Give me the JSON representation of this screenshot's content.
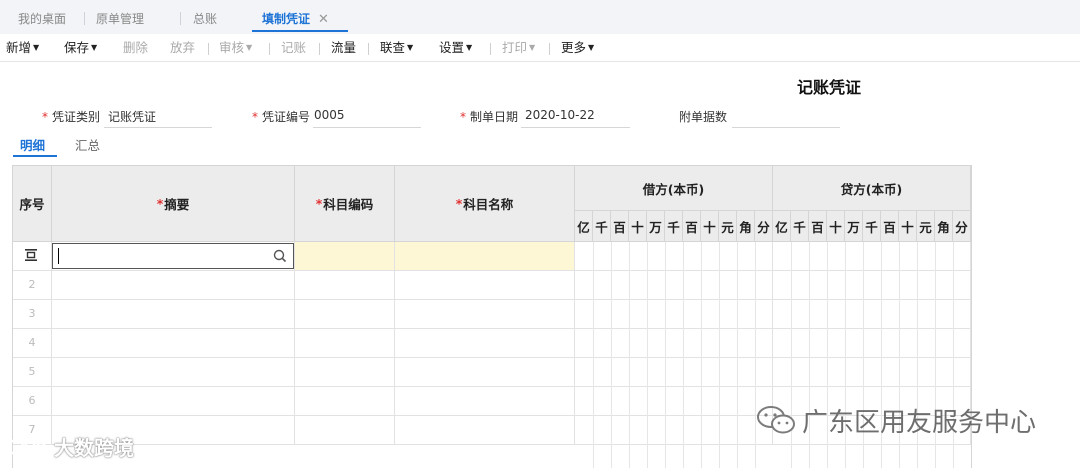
{
  "tabs": [
    {
      "label": "我的桌面"
    },
    {
      "label": "原单管理"
    },
    {
      "label": "总账"
    },
    {
      "label": "填制凭证",
      "close": "✕"
    }
  ],
  "toolbar": {
    "new": "新增",
    "save": "保存",
    "delete": "删除",
    "discard": "放弃",
    "review": "审核",
    "post": "记账",
    "flow": "流量",
    "query": "联查",
    "settings": "设置",
    "print": "打印",
    "more": "更多"
  },
  "voucher": {
    "title": "记账凭证",
    "type_label": "凭证类别",
    "type_value": "记账凭证",
    "number_label": "凭证编号",
    "number_value": "0005",
    "date_label": "制单日期",
    "date_value": "2020-10-22",
    "attach_label": "附单据数",
    "attach_value": ""
  },
  "subtabs": {
    "detail": "明细",
    "summary": "汇总"
  },
  "grid": {
    "headers": {
      "seq": "序号",
      "summary": "摘要",
      "account_code": "科目编码",
      "account_name": "科目名称",
      "debit": "借方(本币)",
      "credit": "贷方(本币)"
    },
    "digits": [
      "亿",
      "千",
      "百",
      "十",
      "万",
      "千",
      "百",
      "十",
      "元",
      "角",
      "分"
    ],
    "row_numbers": [
      "2",
      "3",
      "4",
      "5",
      "6",
      "7"
    ],
    "required_mark": "*"
  },
  "watermarks": {
    "right": "广东区用友服务中心",
    "left": "大数跨境"
  },
  "colors": {
    "accent": "#1e74d6",
    "required": "#e0302f",
    "active_row": "#fef7d6",
    "header_bg": "#ececec"
  }
}
